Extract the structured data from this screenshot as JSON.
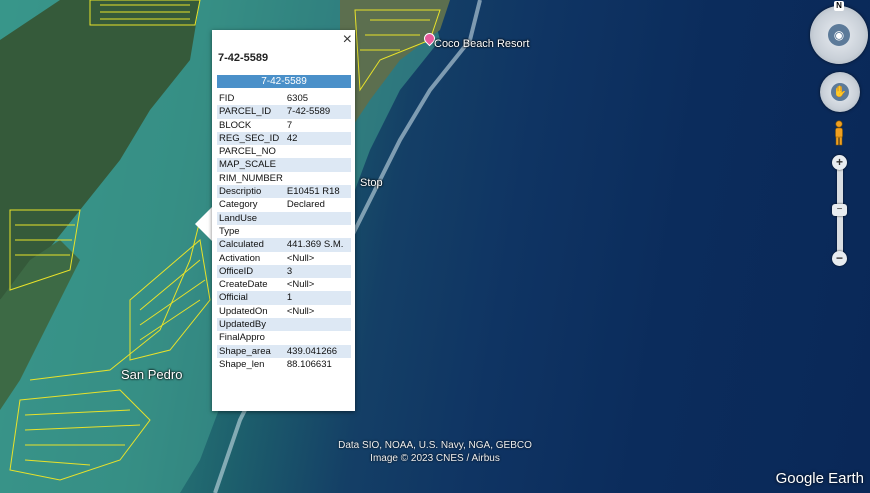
{
  "map": {
    "place_label": "San Pedro",
    "poi_label": "Coco Beach Resort",
    "partial_label": "Stop",
    "attribution_line1": "Data SIO, NOAA, U.S. Navy, NGA, GEBCO",
    "attribution_line2": "Image © 2023 CNES / Airbus",
    "brand": "Google Earth"
  },
  "balloon": {
    "close_glyph": "×",
    "title": "7-42-5589",
    "header": "7-42-5589",
    "rows": [
      {
        "key": "FID",
        "value": "6305"
      },
      {
        "key": "PARCEL_ID",
        "value": "7-42-5589"
      },
      {
        "key": "BLOCK",
        "value": "7"
      },
      {
        "key": "REG_SEC_ID",
        "value": "42"
      },
      {
        "key": "PARCEL_NO",
        "value": ""
      },
      {
        "key": "MAP_SCALE",
        "value": ""
      },
      {
        "key": "RIM_NUMBER",
        "value": ""
      },
      {
        "key": "Descriptio",
        "value": "E10451 R18"
      },
      {
        "key": "Category",
        "value": "Declared"
      },
      {
        "key": "LandUse",
        "value": ""
      },
      {
        "key": "Type",
        "value": ""
      },
      {
        "key": "Calculated",
        "value": "441.369 S.M."
      },
      {
        "key": "Activation",
        "value": "<Null>"
      },
      {
        "key": "OfficeID",
        "value": "3"
      },
      {
        "key": "CreateDate",
        "value": "<Null>"
      },
      {
        "key": "Official",
        "value": "1"
      },
      {
        "key": "UpdatedOn",
        "value": "<Null>"
      },
      {
        "key": "UpdatedBy",
        "value": ""
      },
      {
        "key": "FinalAppro",
        "value": ""
      },
      {
        "key": "Shape_area",
        "value": "439.041266"
      },
      {
        "key": "Shape_len",
        "value": "88.106631"
      }
    ]
  },
  "nav": {
    "north": "N",
    "zoom_in": "+",
    "zoom_out": "−",
    "slider_glyph": "−"
  },
  "colors": {
    "header_blue": "#4a90c9",
    "row_alt": "#dde8f4",
    "parcel_yellow": "#e8e22a"
  }
}
